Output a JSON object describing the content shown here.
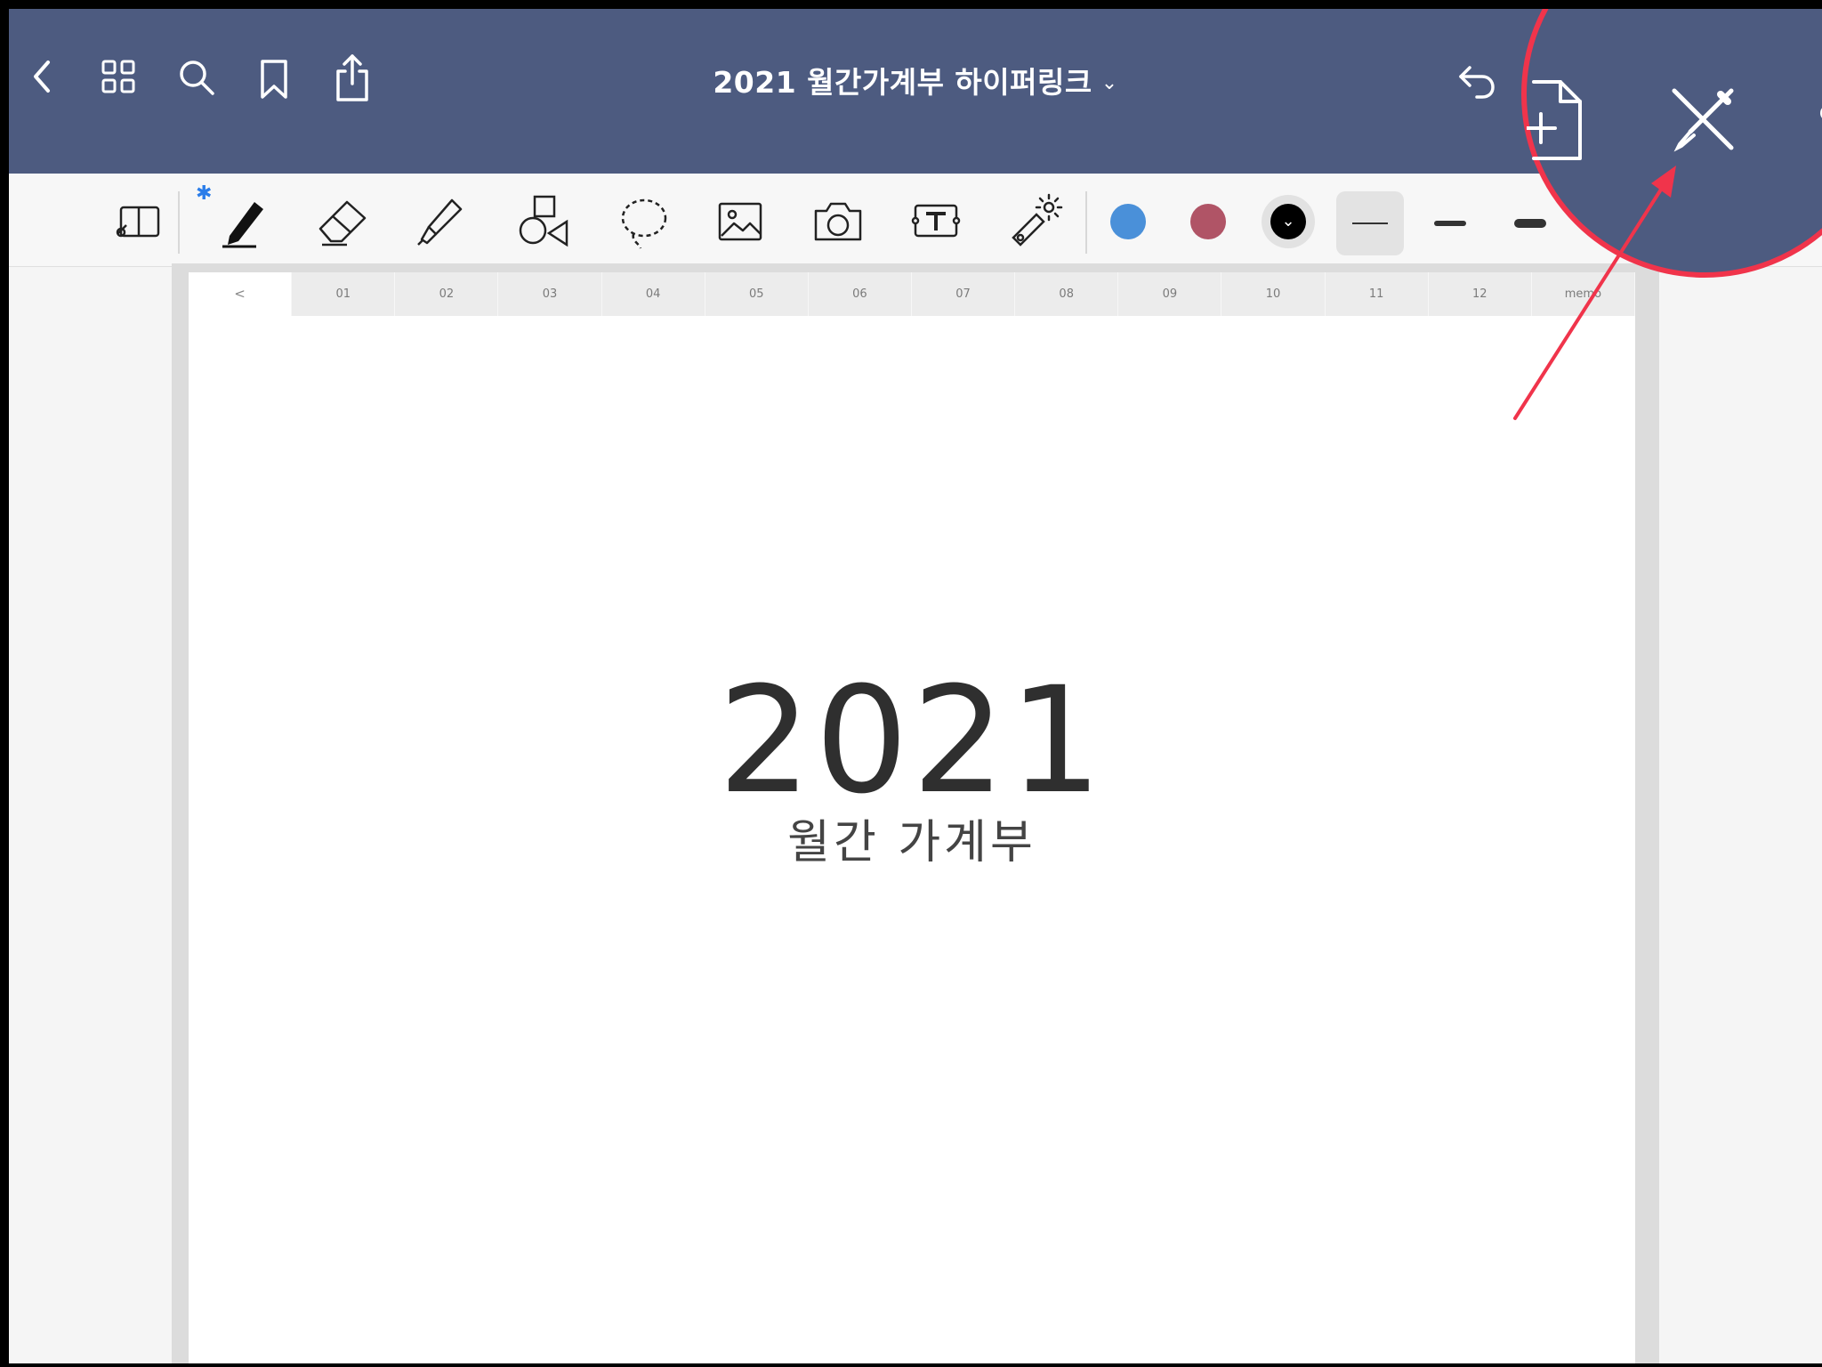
{
  "header": {
    "title": "2021 월간가계부 하이퍼링크",
    "title_chevron": "⌄"
  },
  "icons": {
    "back": "chevron-left-icon",
    "grid": "grid-icon",
    "search": "search-icon",
    "bookmark": "bookmark-icon",
    "share": "share-icon",
    "undo": "undo-icon",
    "add_page": "add-page-icon",
    "close_tools": "pen-close-icon"
  },
  "toolbar": {
    "bluetooth_symbol": "✱",
    "tools": [
      "read-only-mode",
      "pen",
      "eraser",
      "highlighter",
      "shapes",
      "lasso",
      "image",
      "camera",
      "text",
      "laser-pointer"
    ],
    "colors": [
      "#4a90d9",
      "#b05466",
      "#000000"
    ],
    "selected_width_index": 0
  },
  "notebook": {
    "tab_back": "<",
    "tabs": [
      "01",
      "02",
      "03",
      "04",
      "05",
      "06",
      "07",
      "08",
      "09",
      "10",
      "11",
      "12",
      "memo"
    ],
    "year": "2021",
    "subtitle": "월간 가계부"
  },
  "annotation": {
    "highlight_color": "#f0344b",
    "brand_color": "#4d5b80"
  }
}
